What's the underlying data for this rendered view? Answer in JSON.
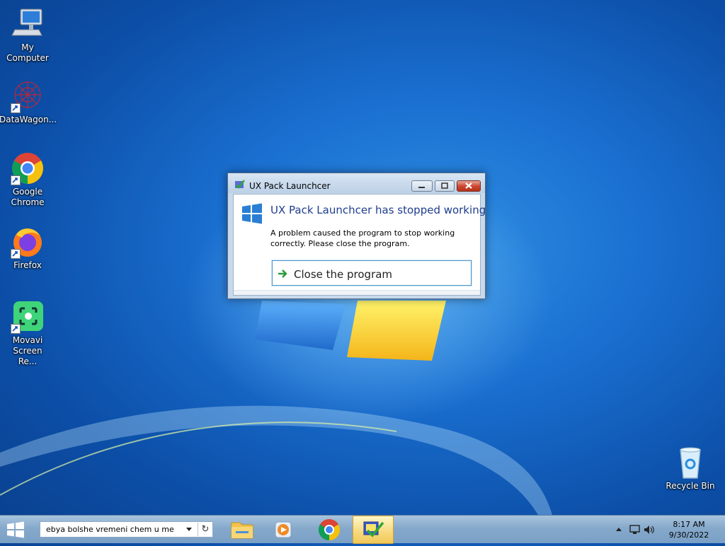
{
  "desktop": {
    "icons": [
      {
        "label": "My Computer"
      },
      {
        "label": "DataWagon..."
      },
      {
        "label": "Google Chrome"
      },
      {
        "label": "Firefox"
      },
      {
        "label": "Movavi Screen Re..."
      },
      {
        "label": "Recycle Bin"
      }
    ]
  },
  "dialog": {
    "title": "UX Pack Launchcer",
    "headline": "UX Pack Launchcer has stopped working",
    "description": "A problem caused the program to stop working correctly. Please close the program.",
    "close_button_label": "Close the program"
  },
  "taskbar": {
    "address_value": "ebya bolshe vremeni chem u me",
    "refresh_icon": "↻",
    "pinned": [
      {
        "icon": "file-explorer-icon"
      },
      {
        "icon": "media-player-icon"
      },
      {
        "icon": "chrome-icon"
      },
      {
        "icon": "ux-pack-launcher-icon",
        "active": true
      }
    ]
  },
  "clock": {
    "time": "8:17 AM",
    "date": "9/30/2022"
  },
  "colors": {
    "headline": "#1e3d8f",
    "close_button_border": "#4f97c9",
    "taskbar": "#86a9cb"
  }
}
